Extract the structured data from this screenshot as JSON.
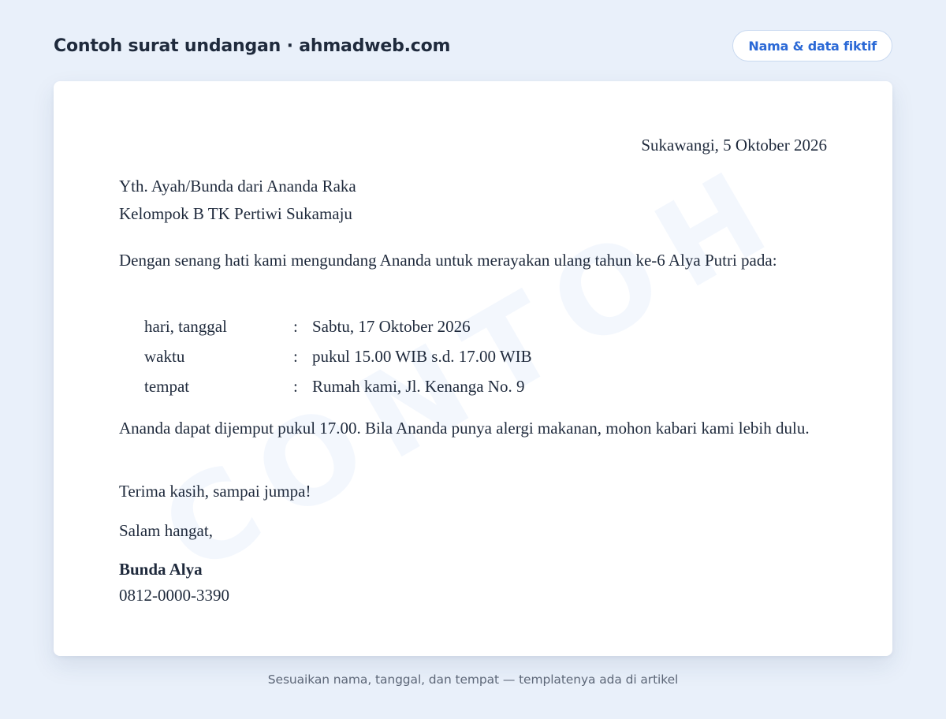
{
  "header": {
    "title": "Contoh surat undangan · ahmadweb.com",
    "badge": "Nama & data fiktif"
  },
  "watermark": "CONTOH",
  "letter": {
    "place_date": "Sukawangi, 5 Oktober 2026",
    "recipient": {
      "line1": "Yth. Ayah/Bunda dari Ananda Raka",
      "line2": "Kelompok B TK Pertiwi Sukamaju"
    },
    "opening": "Dengan senang hati kami mengundang Ananda untuk merayakan ulang tahun ke-6 Alya Putri pada:",
    "details": [
      {
        "label": "hari, tanggal",
        "colon": ":",
        "value": "Sabtu, 17 Oktober 2026"
      },
      {
        "label": "waktu",
        "colon": ":",
        "value": "pukul 15.00 WIB s.d. 17.00 WIB"
      },
      {
        "label": "tempat",
        "colon": ":",
        "value": "Rumah kami, Jl. Kenanga No. 9"
      }
    ],
    "pickup": "Ananda dapat dijemput pukul 17.00. Bila Ananda punya alergi makanan, mohon kabari kami lebih dulu.",
    "thanks": "Terima kasih, sampai jumpa!",
    "closing": "Salam hangat,",
    "sender": {
      "name": "Bunda Alya",
      "phone": "0812-0000-3390"
    }
  },
  "footer": {
    "note": "Sesuaikan nama, tanggal, dan tempat — templatenya ada di artikel"
  },
  "colors": {
    "background": "#e9f0fa",
    "accent": "#2b69d6",
    "text": "#1f2a3c",
    "muted": "#5d6778"
  }
}
